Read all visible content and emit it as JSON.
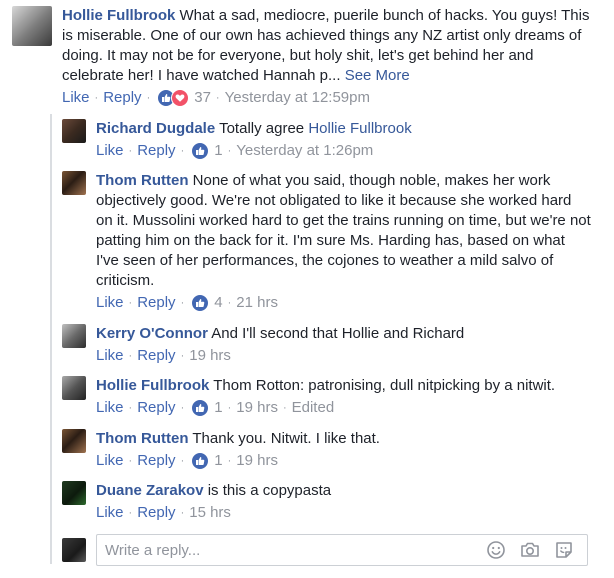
{
  "comments": [
    {
      "author": "Hollie Fullbrook",
      "text": "What a sad, mediocre, puerile bunch of hacks. You guys! This is miserable. One of our own has achieved things any NZ artist only dreams of doing. It may not be for everyone, but holy shit, let's get behind her and celebrate her! I have watched Hannah p...",
      "see_more": "See More",
      "like": "Like",
      "reply": "Reply",
      "reactions": "37",
      "time": "Yesterday at 12:59pm"
    }
  ],
  "replies": [
    {
      "author": "Richard Dugdale",
      "text": "Totally agree",
      "mention": "Hollie Fullbrook",
      "like": "Like",
      "reply": "Reply",
      "reactions": "1",
      "time": "Yesterday at 1:26pm"
    },
    {
      "author": "Thom Rutten",
      "text": "None of what you said, though noble, makes her work objectively good. We're not obligated to like it because she worked hard on it. Mussolini worked hard to get the trains running on time, but we're not patting him on the back for it. I'm sure Ms. Harding has, based on what I've seen of her performances, the cojones to weather a mild salvo of criticism.",
      "like": "Like",
      "reply": "Reply",
      "reactions": "4",
      "time": "21 hrs"
    },
    {
      "author": "Kerry O'Connor",
      "text": "And I'll second that Hollie and Richard",
      "like": "Like",
      "reply": "Reply",
      "time": "19 hrs"
    },
    {
      "author": "Hollie Fullbrook",
      "text": "Thom Rotton: patronising, dull nitpicking by a nitwit.",
      "like": "Like",
      "reply": "Reply",
      "reactions": "1",
      "time": "19 hrs",
      "edited": "Edited"
    },
    {
      "author": "Thom Rutten",
      "text": "Thank you. Nitwit. I like that.",
      "like": "Like",
      "reply": "Reply",
      "reactions": "1",
      "time": "19 hrs"
    },
    {
      "author": "Duane Zarakov",
      "text": "is this a copypasta",
      "like": "Like",
      "reply": "Reply",
      "time": "15 hrs"
    }
  ],
  "reply_box": {
    "placeholder": "Write a reply..."
  },
  "icons": {
    "like": "like-reaction-icon",
    "love": "love-reaction-icon",
    "emoji": "emoji-icon",
    "camera": "camera-icon",
    "sticker": "sticker-icon"
  },
  "colors": {
    "link": "#365899",
    "action": "#4267b2",
    "meta": "#90949c",
    "like": "#4267b2",
    "love": "#f25268"
  }
}
